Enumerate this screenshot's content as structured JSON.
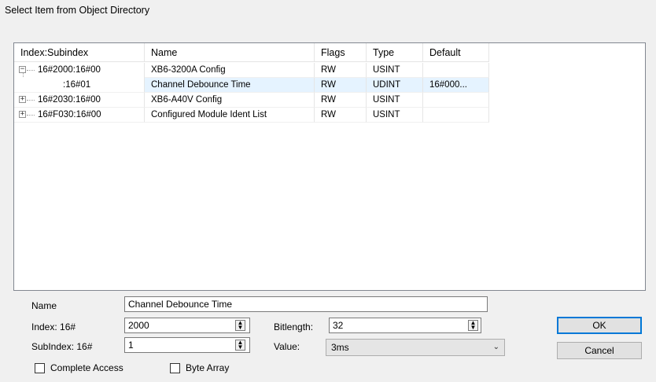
{
  "dialog": {
    "title": "Select Item from Object Directory"
  },
  "tree": {
    "columns": [
      "Index:Subindex",
      "Name",
      "Flags",
      "Type",
      "Default"
    ],
    "rows": [
      {
        "index": "16#2000:16#00",
        "name": "XB6-3200A Config",
        "flags": "RW",
        "type": "USINT",
        "default": "",
        "expander": "−"
      },
      {
        "index": ":16#01",
        "name": "Channel Debounce Time",
        "flags": "RW",
        "type": "UDINT",
        "default": "16#000...",
        "expander": ""
      },
      {
        "index": "16#2030:16#00",
        "name": "XB6-A40V Config",
        "flags": "RW",
        "type": "USINT",
        "default": "",
        "expander": "+"
      },
      {
        "index": "16#F030:16#00",
        "name": "Configured Module Ident List",
        "flags": "RW",
        "type": "USINT",
        "default": "",
        "expander": "+"
      }
    ]
  },
  "form": {
    "name_label": "Name",
    "name_value": "Channel Debounce Time",
    "index_label": "Index: 16#",
    "index_value": "2000",
    "subindex_label": "SubIndex: 16#",
    "subindex_value": "1",
    "bitlength_label": "Bitlength:",
    "bitlength_value": "32",
    "value_label": "Value:",
    "value_selected": "3ms",
    "complete_access_label": "Complete Access",
    "byte_array_label": "Byte Array"
  },
  "buttons": {
    "ok": "OK",
    "cancel": "Cancel"
  },
  "colors": {
    "selection": "#e5f3ff",
    "default_button_border": "#0078d7"
  }
}
